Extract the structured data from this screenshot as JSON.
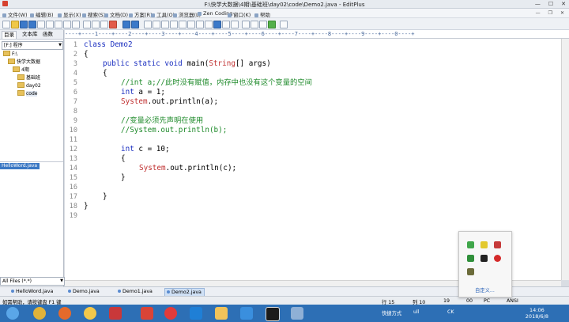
{
  "window": {
    "title": "F:\\快学大数据\\4期\\基础班\\day02\\code\\Demo2.java - EditPlus"
  },
  "menu": [
    "文件(W)",
    "编辑(B)",
    "显示(X)",
    "搜索(S)",
    "文档(D)",
    "方案(R)",
    "工具(O)",
    "浏览器(L)",
    "Zen Coding",
    "窗口(K)",
    "帮助"
  ],
  "left_panel": {
    "tabs": [
      "目录",
      "文本库",
      "函数"
    ],
    "drive": "[F:] 程序",
    "tree": [
      "F:\\",
      "快学大数据",
      "4期",
      "基础班",
      "day02",
      "code"
    ],
    "files": [
      "HelloWord.java"
    ],
    "filter": "All Files (*.*)"
  },
  "ruler": "----+----1----+----2----+----3----+----4----+----5----+----6----+----7----+----8----+----9----+----0----+",
  "editor": {
    "line_numbers": [
      "1",
      "2",
      "3",
      "4",
      "5",
      "6",
      "7",
      "8",
      "9",
      "10",
      "11",
      "12",
      "13",
      "14",
      "15",
      "16",
      "17",
      "18",
      "19"
    ],
    "l1": "class Demo2",
    "l2": "{",
    "l3_kw": "public static void",
    "l3_rest": " main(",
    "l3_ty": "String",
    "l3_end": "[] args)",
    "l4": "{",
    "l5_cm": "//int a;//此时没有赋值，内存中也没有这个变量的空间",
    "l6_kw": "int",
    "l6_rest": " a = 1;",
    "l7_ty": "System",
    "l7_rest": ".out.println(a);",
    "l9_cm": "//变量必须先声明在使用",
    "l10_cm": "//System.out.println(b);",
    "l12_kw": "int",
    "l12_rest": " c = 10;",
    "l13": "{",
    "l14_ty": "System",
    "l14_rest": ".out.println(c);",
    "l15": "}",
    "l17": "}",
    "l18": "}"
  },
  "doc_tabs": [
    "HelloWord.java",
    "Demo.java",
    "Demo1.java",
    "Demo2.java"
  ],
  "status": {
    "help": "如需帮助，请按键盘 F1 键",
    "line": "行 15",
    "col": "列 10",
    "num": "19",
    "flag1": "00",
    "flag2": "PC",
    "encoding": "ANSI"
  },
  "tray_popup": {
    "customize": "自定义..."
  },
  "taskbar": {
    "shortcut": "快捷方式",
    "tray_text": "ull",
    "tray_ck": "CK",
    "time": "14:06",
    "date": "2018/6/8"
  },
  "colors": {
    "keyword": "#1b2fc0",
    "type": "#c03030",
    "comment": "#1e8a2a",
    "taskbar": "#2d6fb5",
    "selection": "#3b78c4"
  }
}
